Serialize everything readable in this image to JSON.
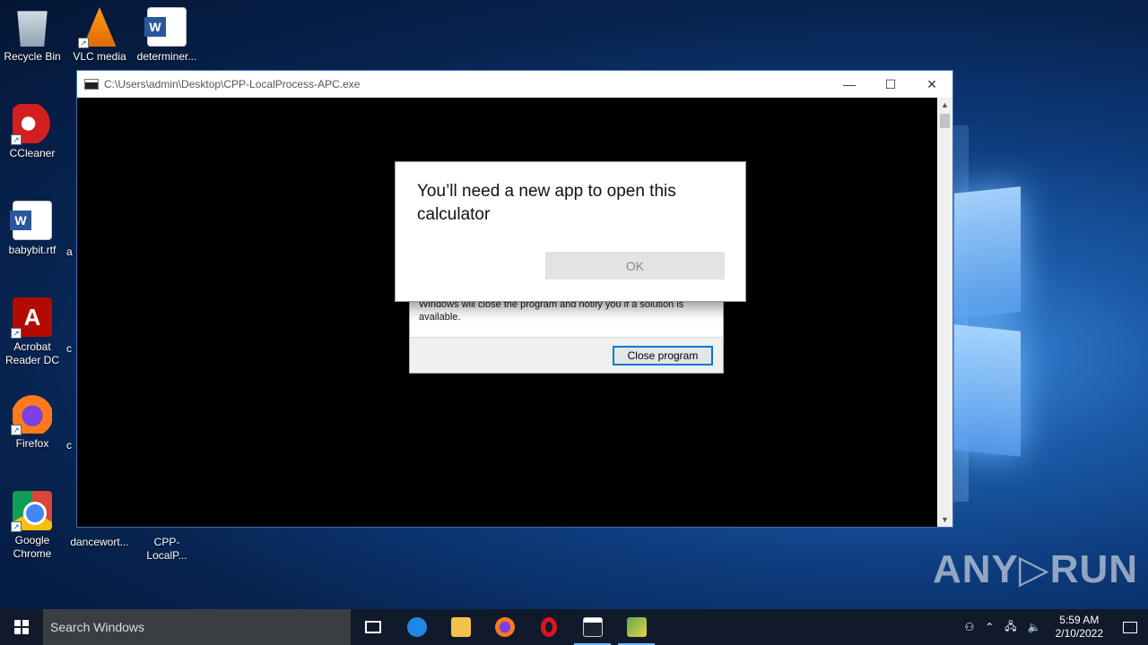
{
  "desktop": {
    "icons": [
      {
        "label": "Recycle Bin"
      },
      {
        "label": "VLC media"
      },
      {
        "label": "determiner..."
      },
      {
        "label": "CCleaner"
      },
      {
        "label": "babybit.rtf"
      },
      {
        "label": "Acrobat Reader DC"
      },
      {
        "label": "Firefox"
      },
      {
        "label": "Google Chrome"
      },
      {
        "label": "dancewort..."
      },
      {
        "label": "CPP-LocalP..."
      }
    ],
    "partial_labels": [
      "a",
      "c",
      "c"
    ]
  },
  "console_window": {
    "title": "C:\\Users\\admin\\Desktop\\CPP-LocalProcess-APC.exe",
    "minimize": "—",
    "maximize": "☐",
    "close": "✕"
  },
  "crash_dialog": {
    "message": "Windows will close the program and notify you if a solution is available.",
    "button": "Close program"
  },
  "app_dialog": {
    "heading": "You’ll need a new app to open this calculator",
    "ok": "OK"
  },
  "taskbar": {
    "search_placeholder": "Search Windows",
    "time": "5:59 AM",
    "date": "2/10/2022"
  },
  "watermark": "ANY▷RUN"
}
